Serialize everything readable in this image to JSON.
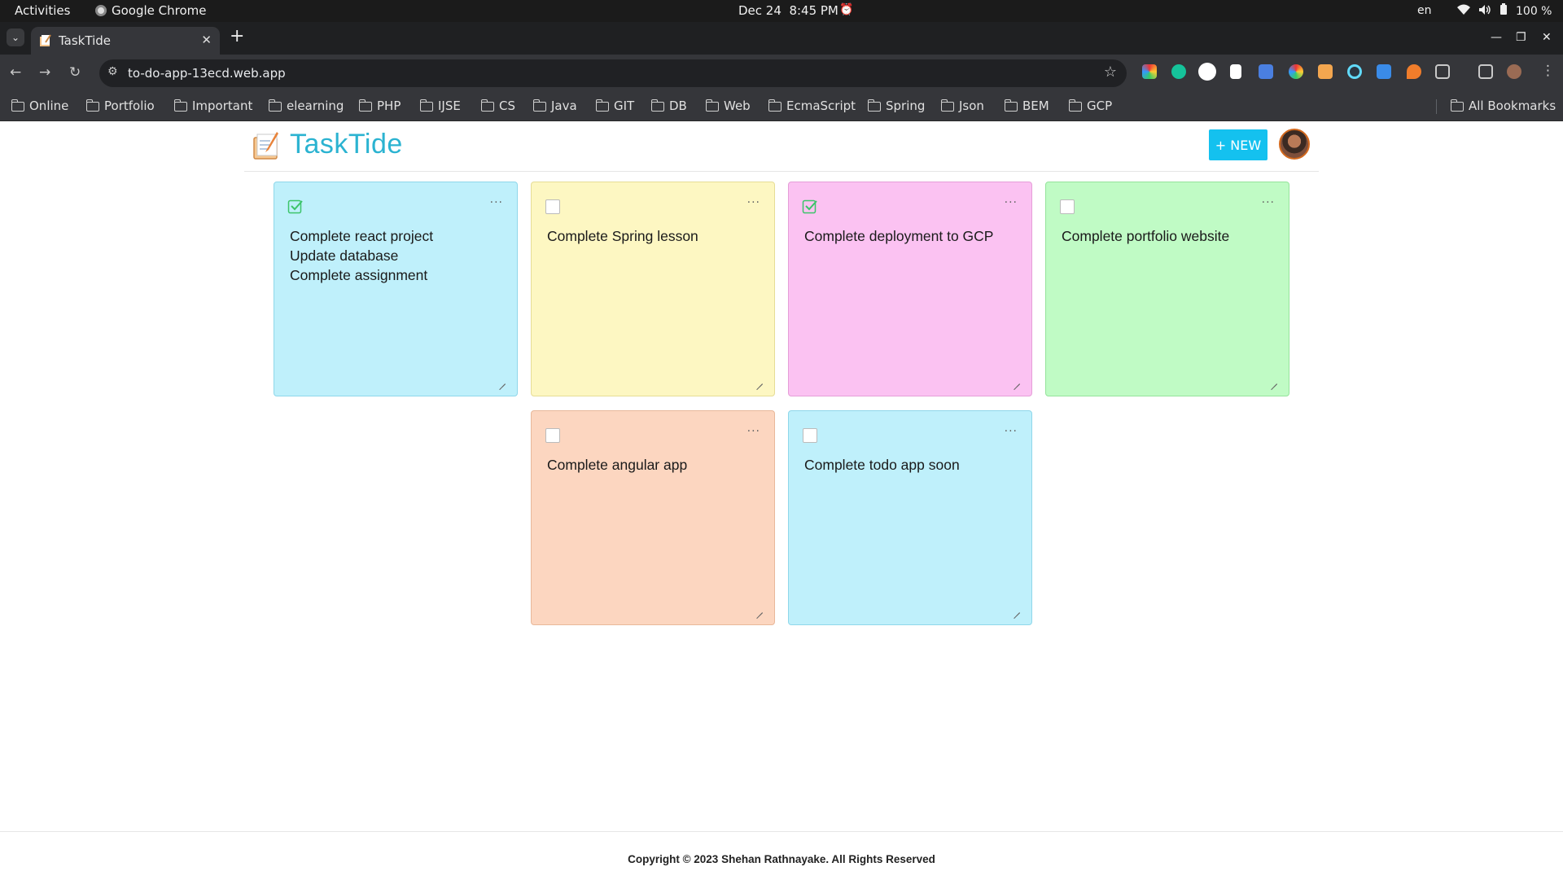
{
  "system_bar": {
    "activities": "Activities",
    "app_name": "Google Chrome",
    "date": "Dec 24",
    "time": "8:45 PM",
    "language": "en",
    "battery": "100 %"
  },
  "browser": {
    "tab_title": "TaskTide",
    "url": "to-do-app-13ecd.web.app",
    "bookmarks": [
      "Online",
      "Portfolio",
      "Important",
      "elearning",
      "PHP",
      "IJSE",
      "CS",
      "Java",
      "GIT",
      "DB",
      "Web",
      "EcmaScript",
      "Spring",
      "Json",
      "BEM",
      "GCP"
    ],
    "all_bookmarks": "All Bookmarks"
  },
  "app": {
    "title": "TaskTide",
    "new_button": "+ NEW"
  },
  "colors": {
    "brand": "#2bb3d1",
    "new_button": "#14c1ef",
    "card_blue": "#bff0fb",
    "card_yellow": "#fdf7c2",
    "card_pink": "#fbc2f2",
    "card_green": "#c0fbc5",
    "card_peach": "#fcd6c0",
    "check_green": "#3cc46a"
  },
  "notes": [
    {
      "text": "Complete react project\nUpdate database\nComplete assignment",
      "done": true,
      "color": "card_blue"
    },
    {
      "text": "Complete Spring lesson",
      "done": false,
      "color": "card_yellow"
    },
    {
      "text": "Complete deployment to GCP",
      "done": true,
      "color": "card_pink"
    },
    {
      "text": "Complete portfolio website",
      "done": false,
      "color": "card_green"
    },
    {
      "text": "Complete angular app",
      "done": false,
      "color": "card_peach"
    },
    {
      "text": "Complete todo app soon",
      "done": false,
      "color": "card_blue"
    }
  ],
  "menu_icon": "···",
  "footer": {
    "copyright": "Copyright © 2023 Shehan Rathnayake. All Rights Reserved"
  }
}
